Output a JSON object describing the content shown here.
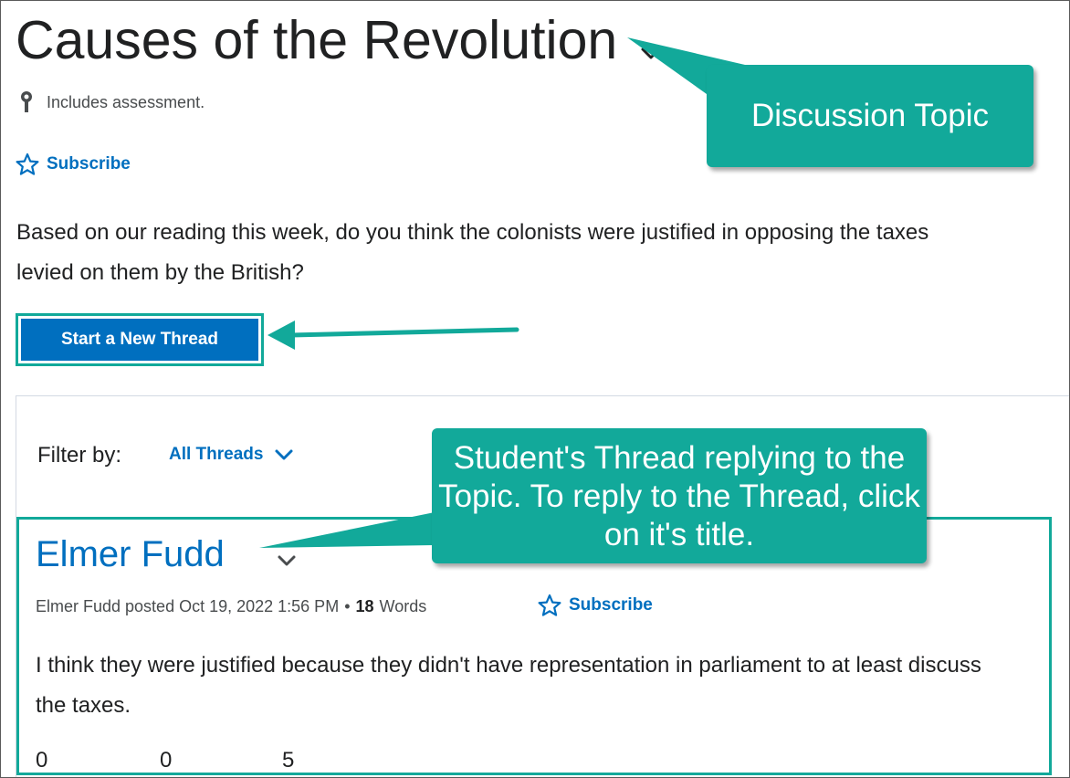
{
  "topic": {
    "title": "Causes of the Revolution",
    "assessment_text": "Includes assessment.",
    "subscribe_label": "Subscribe",
    "body": "Based on our reading this week, do you think the colonists were justified in opposing the taxes levied on them by the British?",
    "new_thread_label": "Start a New Thread"
  },
  "filter": {
    "label": "Filter by:",
    "selected": "All Threads"
  },
  "thread": {
    "title": "Elmer Fudd",
    "meta_posted": "Elmer Fudd posted Oct 19, 2022 1:56 PM",
    "meta_bullet": "•",
    "word_count": "18",
    "word_label": "Words",
    "subscribe_label": "Subscribe",
    "body": "I think they were justified because they didn't have representation in parliament to at least discuss the taxes.",
    "stats": [
      "0",
      "0",
      "5"
    ]
  },
  "annotations": {
    "topic_callout": "Discussion Topic",
    "thread_callout": "Student's Thread replying to the Topic. To reply to the Thread, click on it's title.",
    "accent_color": "#12a99a"
  },
  "colors": {
    "link": "#006fbf",
    "button": "#006fbf",
    "text": "#202122"
  },
  "icons": [
    "ribbon-icon",
    "star-icon",
    "chevron-down-icon"
  ]
}
